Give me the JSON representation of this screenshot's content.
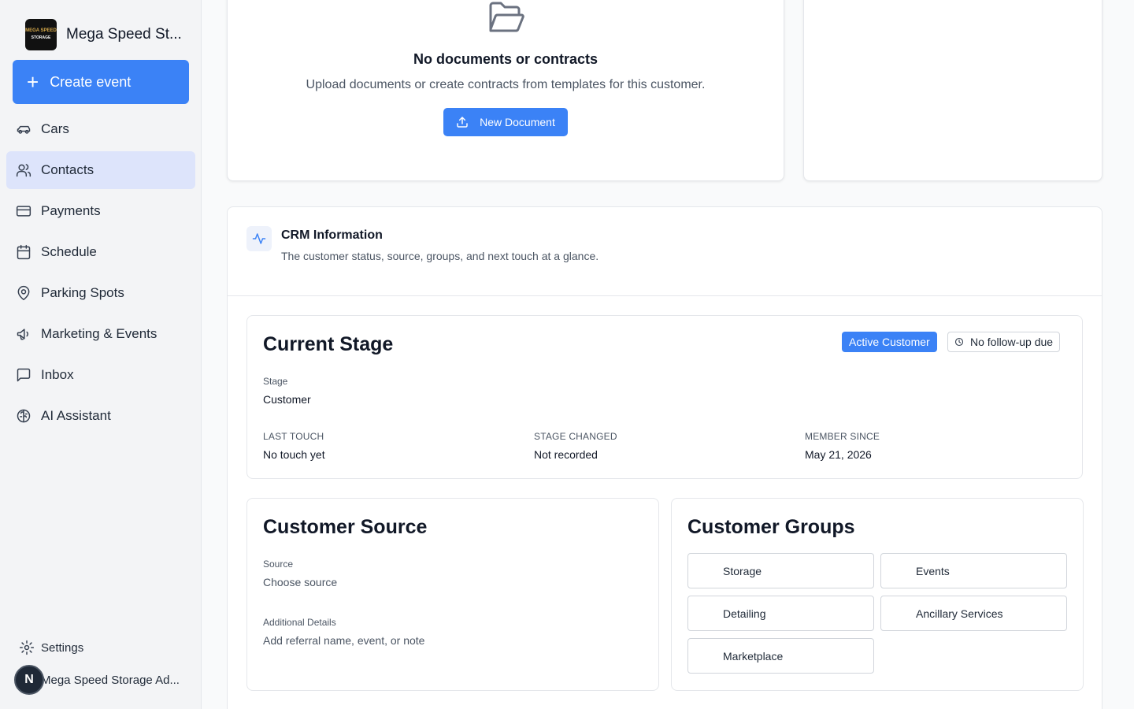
{
  "sidebar": {
    "brand_name": "Mega Speed St...",
    "logo": {
      "line1": "MEGA SPEED",
      "line2": "STORAGE"
    },
    "create_label": "Create event",
    "items": [
      {
        "label": "Cars",
        "icon": "car-icon"
      },
      {
        "label": "Contacts",
        "icon": "users-icon",
        "active": true
      },
      {
        "label": "Payments",
        "icon": "credit-card-icon"
      },
      {
        "label": "Schedule",
        "icon": "calendar-icon"
      },
      {
        "label": "Parking Spots",
        "icon": "map-pin-icon"
      },
      {
        "label": "Marketing & Events",
        "icon": "megaphone-icon"
      },
      {
        "label": "Inbox",
        "icon": "message-square-icon"
      },
      {
        "label": "AI Assistant",
        "icon": "brain-icon"
      }
    ],
    "settings_label": "Settings",
    "user": {
      "initial": "N",
      "name": "Mega Speed Storage Ad..."
    }
  },
  "documents": {
    "title": "No documents or contracts",
    "subtitle": "Upload documents or create contracts from templates for this customer.",
    "button_label": "New Document"
  },
  "crm": {
    "title": "CRM Information",
    "description": "The customer status, source, groups, and next touch at a glance.",
    "stage": {
      "heading": "Current Stage",
      "badge_active": "Active Customer",
      "badge_followup": "No follow-up due",
      "stage_label": "Stage",
      "stage_value": "Customer",
      "last_touch_label": "LAST TOUCH",
      "last_touch_value": "No touch yet",
      "stage_changed_label": "STAGE CHANGED",
      "stage_changed_value": "Not recorded",
      "member_since_label": "MEMBER SINCE",
      "member_since_value": "May 21, 2026"
    },
    "source": {
      "heading": "Customer Source",
      "source_label": "Source",
      "source_placeholder": "Choose source",
      "details_label": "Additional Details",
      "details_placeholder": "Add referral name, event, or note"
    },
    "groups": {
      "heading": "Customer Groups",
      "items": [
        "Storage",
        "Events",
        "Detailing",
        "Ancillary Services",
        "Marketplace"
      ]
    }
  },
  "colors": {
    "accent": "#3b82f6",
    "active_nav": "#dde4fb",
    "sidebar_bg": "#f3f4f6"
  }
}
